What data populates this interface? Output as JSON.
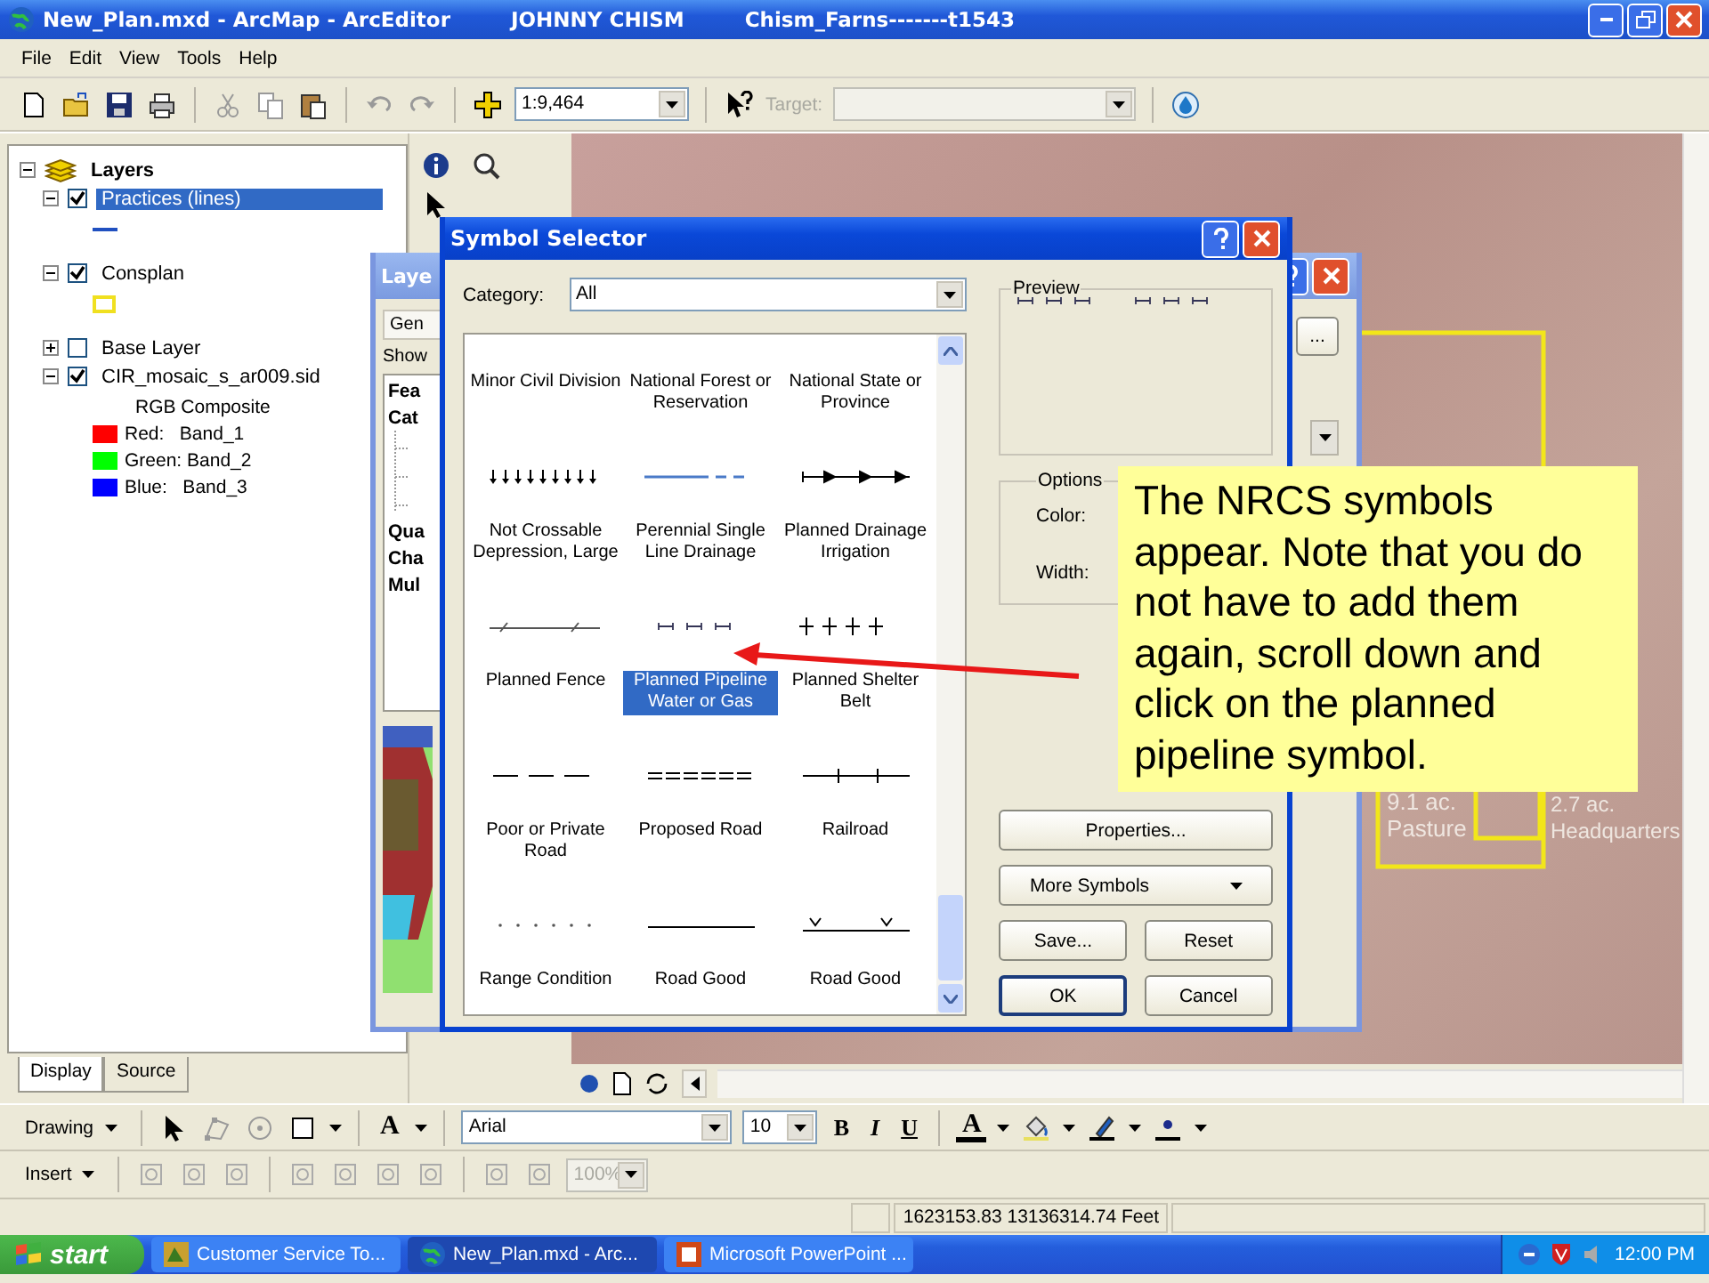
{
  "window": {
    "title": "New_Plan.mxd - ArcMap - ArcEditor",
    "user": "JOHNNY CHISM",
    "document": "Chism_Farns-------t1543"
  },
  "menu": [
    "File",
    "Edit",
    "View",
    "Tools",
    "Help"
  ],
  "toolbar": {
    "scale": "1:9,464",
    "target": {
      "label": "Target:",
      "disabled": true
    }
  },
  "toc": {
    "root": {
      "label": "Layers",
      "expanded": true
    },
    "layers": [
      {
        "label": "Practices (lines)",
        "checked": true,
        "expanded": true,
        "selected": true,
        "legend": [
          {
            "kind": "line",
            "color": "#2050c0"
          }
        ]
      },
      {
        "label": "Consplan",
        "checked": true,
        "expanded": true,
        "selected": false,
        "legend": [
          {
            "kind": "outline",
            "color": "#f0e020"
          }
        ]
      },
      {
        "label": "Base Layer",
        "checked": false,
        "expanded": false,
        "selected": false
      },
      {
        "label": "CIR_mosaic_s_ar009.sid",
        "checked": true,
        "expanded": true,
        "selected": false,
        "legend": [
          {
            "kind": "text",
            "label": "RGB Composite"
          },
          {
            "kind": "swatch",
            "color": "#ff0000",
            "label": "Red:   Band_1"
          },
          {
            "kind": "swatch",
            "color": "#00ff00",
            "label": "Green: Band_2"
          },
          {
            "kind": "swatch",
            "color": "#0000ff",
            "label": "Blue:   Band_3"
          }
        ]
      }
    ],
    "tabs": [
      {
        "label": "Display",
        "selected": true
      },
      {
        "label": "Source",
        "selected": false
      }
    ]
  },
  "map": {
    "labels": [
      {
        "lines": [
          "9.1 ac.",
          "Pasture"
        ]
      },
      {
        "lines": [
          "2.7 ac.",
          "Headquarters"
        ]
      }
    ]
  },
  "layer_dialog": {
    "title": "Laye",
    "tab": "Gen",
    "show_label": "Show",
    "top_fields": [
      "Fea",
      "Cat"
    ],
    "bottom_fields": [
      "Qua",
      "Cha",
      "Mul"
    ],
    "side_button": "..."
  },
  "symbol_selector": {
    "title": "Symbol Selector",
    "category_label": "Category:",
    "category": "All",
    "symbols": [
      {
        "label": "Minor Civil Division",
        "kind": "none",
        "selected": false
      },
      {
        "label": "National Forest or Reservation",
        "kind": "none",
        "selected": false
      },
      {
        "label": "National State or Province",
        "kind": "none",
        "selected": false
      },
      {
        "label": "Not Crossable Depression, Large",
        "kind": "ticks",
        "selected": false
      },
      {
        "label": "Perennial Single Line Drainage",
        "kind": "blue-dash",
        "selected": false
      },
      {
        "label": "Planned Drainage Irrigation",
        "kind": "arrows",
        "selected": false
      },
      {
        "label": "Planned Fence",
        "kind": "fence",
        "selected": false
      },
      {
        "label": "Planned Pipeline Water or Gas",
        "kind": "pipeline",
        "selected": true
      },
      {
        "label": "Planned Shelter Belt",
        "kind": "plus",
        "selected": false
      },
      {
        "label": "Poor or Private Road",
        "kind": "dash",
        "selected": false
      },
      {
        "label": "Proposed Road",
        "kind": "double",
        "selected": false
      },
      {
        "label": "Railroad",
        "kind": "rail",
        "selected": false
      },
      {
        "label": "Range Condition",
        "kind": "dots",
        "selected": false
      },
      {
        "label": "Road Good",
        "kind": "solid",
        "selected": false
      },
      {
        "label": "Road Good",
        "kind": "fenced",
        "selected": false
      }
    ],
    "preview_label": "Preview",
    "preview": {
      "kind": "pipeline"
    },
    "options_label": "Options",
    "color_label": "Color:",
    "width_label": "Width:",
    "buttons": [
      {
        "label": "Properties...",
        "kind": "wide"
      },
      {
        "label": "More Symbols",
        "kind": "menu"
      },
      {
        "label": "Save...",
        "kind": "half"
      },
      {
        "label": "Reset",
        "kind": "half"
      },
      {
        "label": "OK",
        "kind": "default"
      },
      {
        "label": "Cancel",
        "kind": "half"
      }
    ]
  },
  "callout": {
    "text": "The NRCS symbols appear. Note that you do not have to add them again, scroll down and click on the planned pipeline symbol."
  },
  "drawing_bar": {
    "label": "Drawing",
    "text_tool": "A",
    "font": "Arial",
    "size": "10",
    "styles": [
      "B",
      "I",
      "U"
    ],
    "font_color": "A"
  },
  "insert_bar": {
    "label": "Insert",
    "zoom": "100%",
    "zoom_disabled": true
  },
  "status_bar": {
    "coordinates": "1623153.83  13136314.74 Feet"
  },
  "taskbar": {
    "start": "start",
    "tasks": [
      {
        "label": "Customer Service To...",
        "selected": false
      },
      {
        "label": "New_Plan.mxd - Arc...",
        "selected": true
      },
      {
        "label": "Microsoft PowerPoint ...",
        "selected": false
      }
    ],
    "clock": "12:00 PM"
  }
}
